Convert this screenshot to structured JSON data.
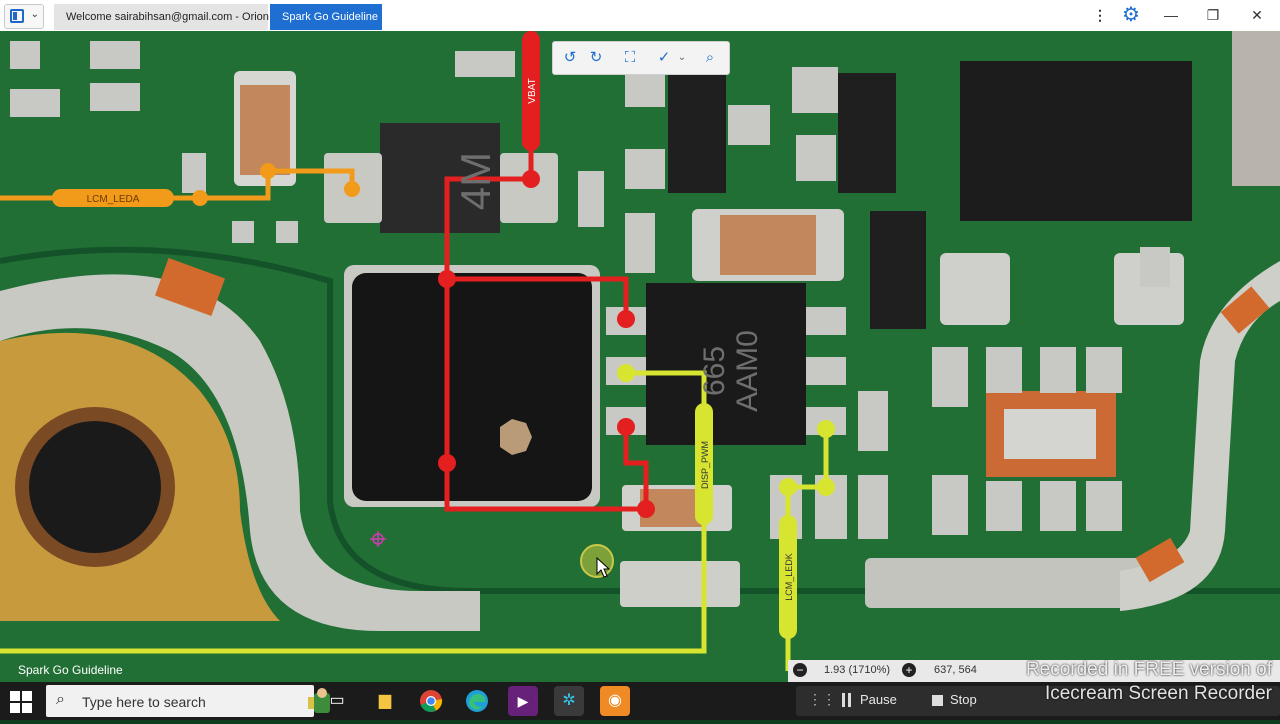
{
  "window": {
    "tabs": [
      {
        "label": "Welcome sairabihsan@gmail.com - Orion",
        "active": false
      },
      {
        "label": "Spark Go Guideline",
        "active": true
      }
    ],
    "icons": [
      "app-menu-icon",
      "kebab-menu-icon",
      "settings-gear-icon",
      "minimize-icon",
      "maximize-icon",
      "close-icon"
    ],
    "accent": "#1e6fd1"
  },
  "viewer_toolbar": {
    "icons": [
      "rotate-left-icon",
      "rotate-right-icon",
      "fit-screen-icon",
      "check-tool-icon",
      "search-icon"
    ]
  },
  "board": {
    "net_labels": {
      "lcm_leda": "LCM_LEDA",
      "vbat": "VBAT",
      "disp_pwm": "DISP_PWM",
      "lcm_ledk": "LCM_LEDK"
    },
    "chip_markings": {
      "coil": "4M",
      "ic": "665\nAAM0"
    },
    "net_colors": {
      "orange": "#f29a1a",
      "red": "#e41f1f",
      "yellow": "#d7e530"
    },
    "watermark": "Spark Go Guideline"
  },
  "zoom": {
    "value": "1.93 (1710%)",
    "coords": "637, 564"
  },
  "recorder": {
    "watermark_line1": "Recorded in FREE version of",
    "watermark_line2": "Icecream Screen Recorder",
    "pause_label": "Pause",
    "stop_label": "Stop"
  },
  "taskbar": {
    "search_placeholder": "Type here to search",
    "apps": [
      "task-view-icon",
      "file-explorer-icon",
      "chrome-icon",
      "edge-icon",
      "visual-studio-icon",
      "orion-app-icon",
      "icecream-recorder-icon"
    ]
  }
}
